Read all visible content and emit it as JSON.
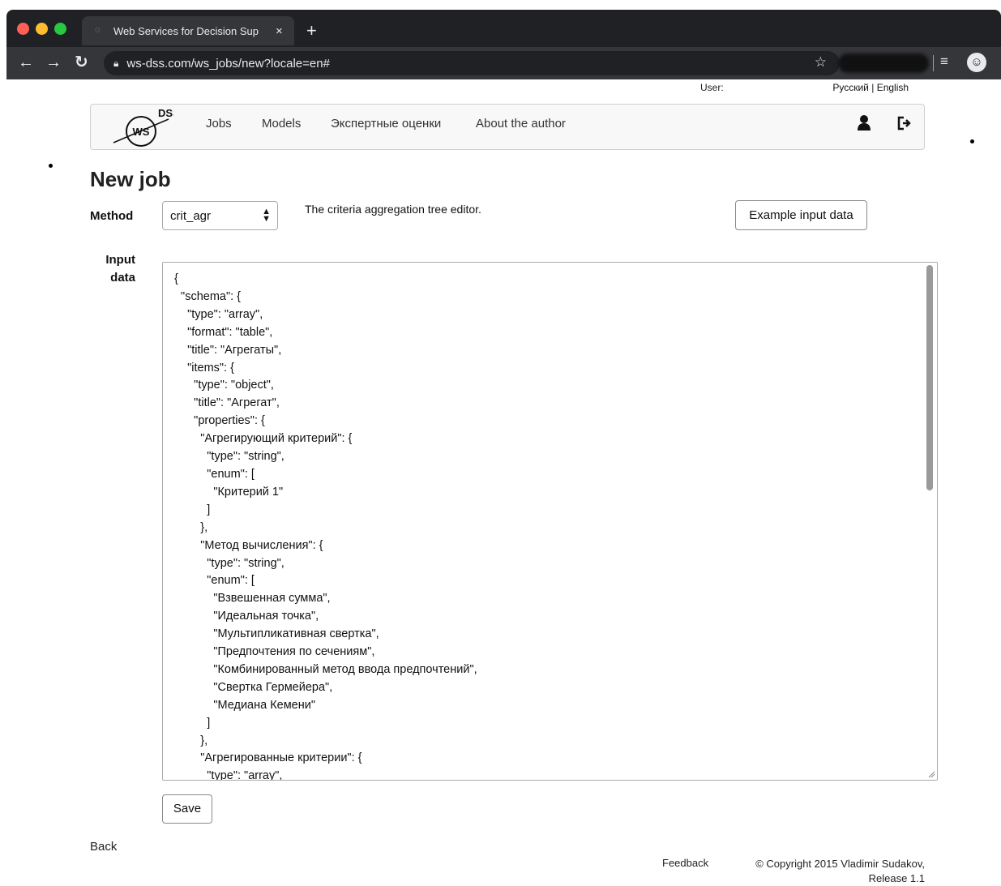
{
  "browser": {
    "tab_title": "Web Services for Decision Sup",
    "tab_close": "×",
    "new_tab": "+",
    "url": "ws-dss.com/ws_jobs/new?locale=en#"
  },
  "header": {
    "user_prefix": "User:",
    "lang_ru": "Русский",
    "lang_sep": "|",
    "lang_en": "English"
  },
  "logo": {
    "main": "WS",
    "sup": "DSS"
  },
  "nav": {
    "items": [
      {
        "label": "Jobs"
      },
      {
        "label": "Models"
      },
      {
        "label": "Экспертные оценки"
      },
      {
        "label": "About the author"
      }
    ]
  },
  "page": {
    "title": "New job",
    "method_label": "Method",
    "method_value": "crit_agr",
    "method_description": "The criteria aggregation tree editor.",
    "example_button": "Example input data",
    "input_label_line1": "Input",
    "input_label_line2": "data",
    "input_data": "{\n  \"schema\": {\n    \"type\": \"array\",\n    \"format\": \"table\",\n    \"title\": \"Агрегаты\",\n    \"items\": {\n      \"type\": \"object\",\n      \"title\": \"Агрегат\",\n      \"properties\": {\n        \"Агрегирующий критерий\": {\n          \"type\": \"string\",\n          \"enum\": [\n            \"Критерий 1\"\n          ]\n        },\n        \"Метод вычисления\": {\n          \"type\": \"string\",\n          \"enum\": [\n            \"Взвешенная сумма\",\n            \"Идеальная точка\",\n            \"Мультипликативная свертка\",\n            \"Предпочтения по сечениям\",\n            \"Комбинированный метод ввода предпочтений\",\n            \"Свертка Гермейера\",\n            \"Медиана Кемени\"\n          ]\n        },\n        \"Агрегированные критерии\": {\n          \"type\": \"array\",",
    "save_button": "Save",
    "back_link": "Back"
  },
  "footer": {
    "feedback": "Feedback",
    "copyright_line1": "© Copyright 2015 Vladimir Sudakov,",
    "copyright_line2": "Release 1.1"
  },
  "icons": {
    "user": "user-icon",
    "logout": "logout-icon",
    "lock": "lock-icon",
    "star": "star-icon"
  }
}
